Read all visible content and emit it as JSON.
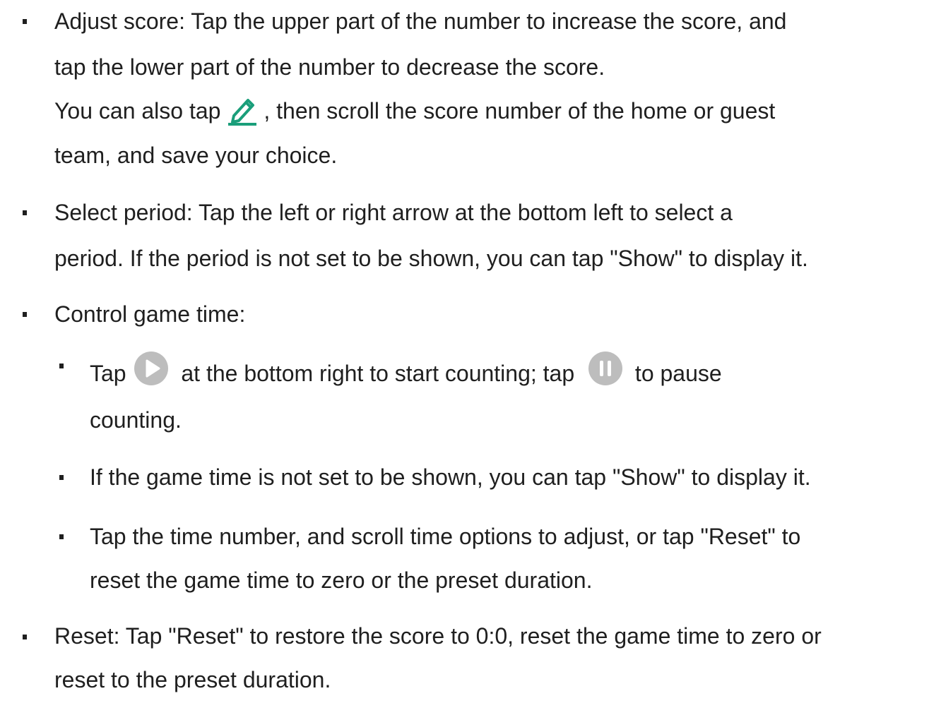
{
  "list": {
    "adjust_score": {
      "line1": "Adjust score: Tap the upper part of the number to increase the score, and",
      "line2": "tap the lower part of the number to decrease the score.",
      "line3_before": "You can also tap ",
      "line3_after": ", then scroll the score number of the home or guest",
      "line4": "team, and save your choice.",
      "icon": "edit-pencil-icon",
      "icon_color": "#1a9e7a"
    },
    "select_period": {
      "line1": "Select period: Tap the left or right arrow at the bottom left to select a",
      "line2": "period. If the period is not set to be shown, you can tap \"Show\" to display it."
    },
    "control_time": {
      "label": "Control game time:",
      "sub": {
        "play_pause": {
          "text1": "Tap ",
          "play_icon": "play-icon",
          "text2": " at the bottom right to start counting; tap ",
          "pause_icon": "pause-icon",
          "text3": " to pause",
          "line2": "counting."
        },
        "show_time": "If the game time is not set to be shown, you can tap \"Show\" to display it.",
        "adjust_time": {
          "line1": "Tap the time number, and scroll time options to adjust, or tap \"Reset\" to",
          "line2": "reset the game time to zero or the preset duration."
        }
      }
    },
    "reset": {
      "line1": "Reset: Tap \"Reset\" to restore the score to 0:0, reset the game time to zero or",
      "line2": "reset to the preset duration."
    }
  },
  "colors": {
    "text": "#1f1f1f",
    "icon_gray": "#bdbdbd",
    "accent": "#1a9e7a"
  }
}
